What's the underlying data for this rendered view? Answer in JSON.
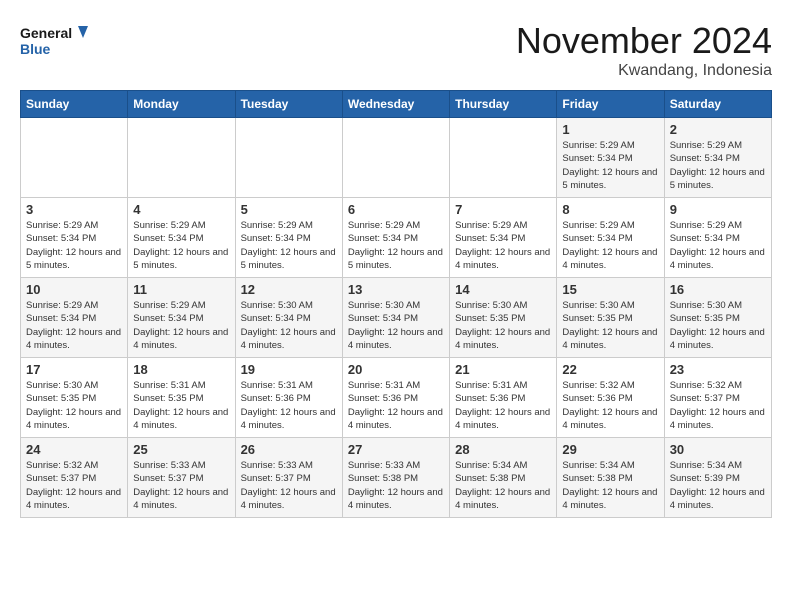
{
  "header": {
    "logo_line1": "General",
    "logo_line2": "Blue",
    "month": "November 2024",
    "location": "Kwandang, Indonesia"
  },
  "weekdays": [
    "Sunday",
    "Monday",
    "Tuesday",
    "Wednesday",
    "Thursday",
    "Friday",
    "Saturday"
  ],
  "weeks": [
    [
      {
        "day": "",
        "text": ""
      },
      {
        "day": "",
        "text": ""
      },
      {
        "day": "",
        "text": ""
      },
      {
        "day": "",
        "text": ""
      },
      {
        "day": "",
        "text": ""
      },
      {
        "day": "1",
        "text": "Sunrise: 5:29 AM\nSunset: 5:34 PM\nDaylight: 12 hours and 5 minutes."
      },
      {
        "day": "2",
        "text": "Sunrise: 5:29 AM\nSunset: 5:34 PM\nDaylight: 12 hours and 5 minutes."
      }
    ],
    [
      {
        "day": "3",
        "text": "Sunrise: 5:29 AM\nSunset: 5:34 PM\nDaylight: 12 hours and 5 minutes."
      },
      {
        "day": "4",
        "text": "Sunrise: 5:29 AM\nSunset: 5:34 PM\nDaylight: 12 hours and 5 minutes."
      },
      {
        "day": "5",
        "text": "Sunrise: 5:29 AM\nSunset: 5:34 PM\nDaylight: 12 hours and 5 minutes."
      },
      {
        "day": "6",
        "text": "Sunrise: 5:29 AM\nSunset: 5:34 PM\nDaylight: 12 hours and 5 minutes."
      },
      {
        "day": "7",
        "text": "Sunrise: 5:29 AM\nSunset: 5:34 PM\nDaylight: 12 hours and 4 minutes."
      },
      {
        "day": "8",
        "text": "Sunrise: 5:29 AM\nSunset: 5:34 PM\nDaylight: 12 hours and 4 minutes."
      },
      {
        "day": "9",
        "text": "Sunrise: 5:29 AM\nSunset: 5:34 PM\nDaylight: 12 hours and 4 minutes."
      }
    ],
    [
      {
        "day": "10",
        "text": "Sunrise: 5:29 AM\nSunset: 5:34 PM\nDaylight: 12 hours and 4 minutes."
      },
      {
        "day": "11",
        "text": "Sunrise: 5:29 AM\nSunset: 5:34 PM\nDaylight: 12 hours and 4 minutes."
      },
      {
        "day": "12",
        "text": "Sunrise: 5:30 AM\nSunset: 5:34 PM\nDaylight: 12 hours and 4 minutes."
      },
      {
        "day": "13",
        "text": "Sunrise: 5:30 AM\nSunset: 5:34 PM\nDaylight: 12 hours and 4 minutes."
      },
      {
        "day": "14",
        "text": "Sunrise: 5:30 AM\nSunset: 5:35 PM\nDaylight: 12 hours and 4 minutes."
      },
      {
        "day": "15",
        "text": "Sunrise: 5:30 AM\nSunset: 5:35 PM\nDaylight: 12 hours and 4 minutes."
      },
      {
        "day": "16",
        "text": "Sunrise: 5:30 AM\nSunset: 5:35 PM\nDaylight: 12 hours and 4 minutes."
      }
    ],
    [
      {
        "day": "17",
        "text": "Sunrise: 5:30 AM\nSunset: 5:35 PM\nDaylight: 12 hours and 4 minutes."
      },
      {
        "day": "18",
        "text": "Sunrise: 5:31 AM\nSunset: 5:35 PM\nDaylight: 12 hours and 4 minutes."
      },
      {
        "day": "19",
        "text": "Sunrise: 5:31 AM\nSunset: 5:36 PM\nDaylight: 12 hours and 4 minutes."
      },
      {
        "day": "20",
        "text": "Sunrise: 5:31 AM\nSunset: 5:36 PM\nDaylight: 12 hours and 4 minutes."
      },
      {
        "day": "21",
        "text": "Sunrise: 5:31 AM\nSunset: 5:36 PM\nDaylight: 12 hours and 4 minutes."
      },
      {
        "day": "22",
        "text": "Sunrise: 5:32 AM\nSunset: 5:36 PM\nDaylight: 12 hours and 4 minutes."
      },
      {
        "day": "23",
        "text": "Sunrise: 5:32 AM\nSunset: 5:37 PM\nDaylight: 12 hours and 4 minutes."
      }
    ],
    [
      {
        "day": "24",
        "text": "Sunrise: 5:32 AM\nSunset: 5:37 PM\nDaylight: 12 hours and 4 minutes."
      },
      {
        "day": "25",
        "text": "Sunrise: 5:33 AM\nSunset: 5:37 PM\nDaylight: 12 hours and 4 minutes."
      },
      {
        "day": "26",
        "text": "Sunrise: 5:33 AM\nSunset: 5:37 PM\nDaylight: 12 hours and 4 minutes."
      },
      {
        "day": "27",
        "text": "Sunrise: 5:33 AM\nSunset: 5:38 PM\nDaylight: 12 hours and 4 minutes."
      },
      {
        "day": "28",
        "text": "Sunrise: 5:34 AM\nSunset: 5:38 PM\nDaylight: 12 hours and 4 minutes."
      },
      {
        "day": "29",
        "text": "Sunrise: 5:34 AM\nSunset: 5:38 PM\nDaylight: 12 hours and 4 minutes."
      },
      {
        "day": "30",
        "text": "Sunrise: 5:34 AM\nSunset: 5:39 PM\nDaylight: 12 hours and 4 minutes."
      }
    ]
  ]
}
